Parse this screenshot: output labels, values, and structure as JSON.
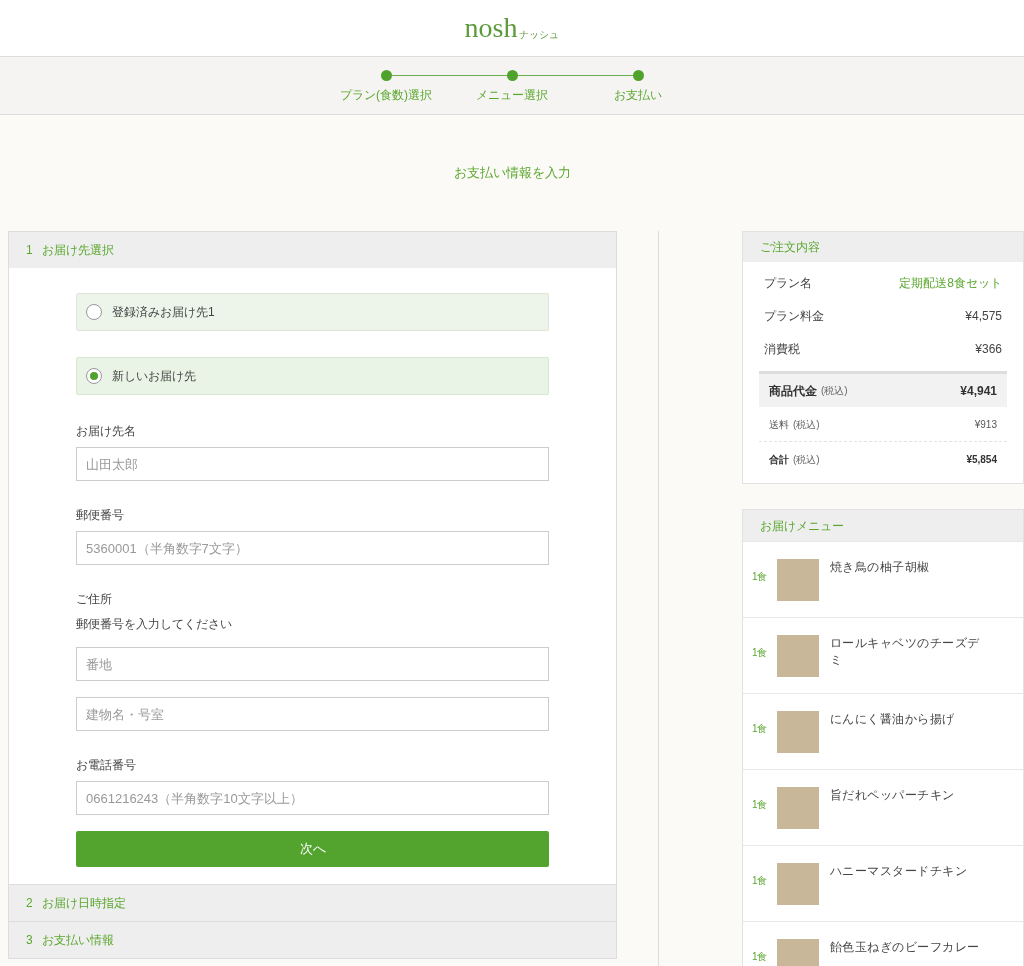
{
  "logo": {
    "text": "nosh",
    "sub": "ナッシュ"
  },
  "steps": [
    {
      "label": "プラン(食数)選択"
    },
    {
      "label": "メニュー選択"
    },
    {
      "label": "お支払い"
    }
  ],
  "page_title": "お支払い情報を入力",
  "sections": [
    {
      "number": "1",
      "title": "お届け先選択",
      "expanded": true
    },
    {
      "number": "2",
      "title": "お届け日時指定",
      "expanded": false
    },
    {
      "number": "3",
      "title": "お支払い情報",
      "expanded": false
    }
  ],
  "delivery_form": {
    "options": [
      {
        "label": "登録済みお届け先1",
        "selected": false
      },
      {
        "label": "新しいお届け先",
        "selected": true
      }
    ],
    "groups": [
      {
        "label": "お届け先名",
        "inputs": [
          {
            "placeholder": "山田太郎"
          }
        ]
      },
      {
        "label": "郵便番号",
        "inputs": [
          {
            "placeholder": "5360001（半角数字7文字）"
          }
        ]
      },
      {
        "label": "ご住所",
        "hint": "郵便番号を入力してください",
        "inputs": [
          {
            "placeholder": "番地"
          },
          {
            "placeholder": "建物名・号室"
          }
        ]
      },
      {
        "label": "お電話番号",
        "inputs": [
          {
            "placeholder": "0661216243（半角数字10文字以上）"
          }
        ]
      }
    ],
    "button": "次へ"
  },
  "order_summary": {
    "title": "ご注文内容",
    "rows": [
      {
        "kind": "plan",
        "label": "プラン名",
        "value": "定期配送8食セット"
      },
      {
        "kind": "plain",
        "label": "プラン料金",
        "value": "¥4,575"
      },
      {
        "kind": "plain",
        "label": "消費税",
        "value": "¥366"
      },
      {
        "kind": "subtotal",
        "label": "商品代金",
        "note": "(税込)",
        "value": "¥4,941"
      },
      {
        "kind": "minor",
        "label": "送料",
        "note": "(税込)",
        "value": "¥913"
      },
      {
        "kind": "total",
        "label": "合計",
        "note": "(税込)",
        "value": "¥5,854"
      }
    ]
  },
  "menu": {
    "title": "お届けメニュー",
    "items": [
      {
        "qty": "1食",
        "name": "焼き鳥の柚子胡椒"
      },
      {
        "qty": "1食",
        "name": "ロールキャベツのチーズデミ"
      },
      {
        "qty": "1食",
        "name": "にんにく醤油から揚げ"
      },
      {
        "qty": "1食",
        "name": "旨だれペッパーチキン"
      },
      {
        "qty": "1食",
        "name": "ハニーマスタードチキン"
      },
      {
        "qty": "1食",
        "name": "飴色玉ねぎのビーフカレー"
      }
    ]
  }
}
